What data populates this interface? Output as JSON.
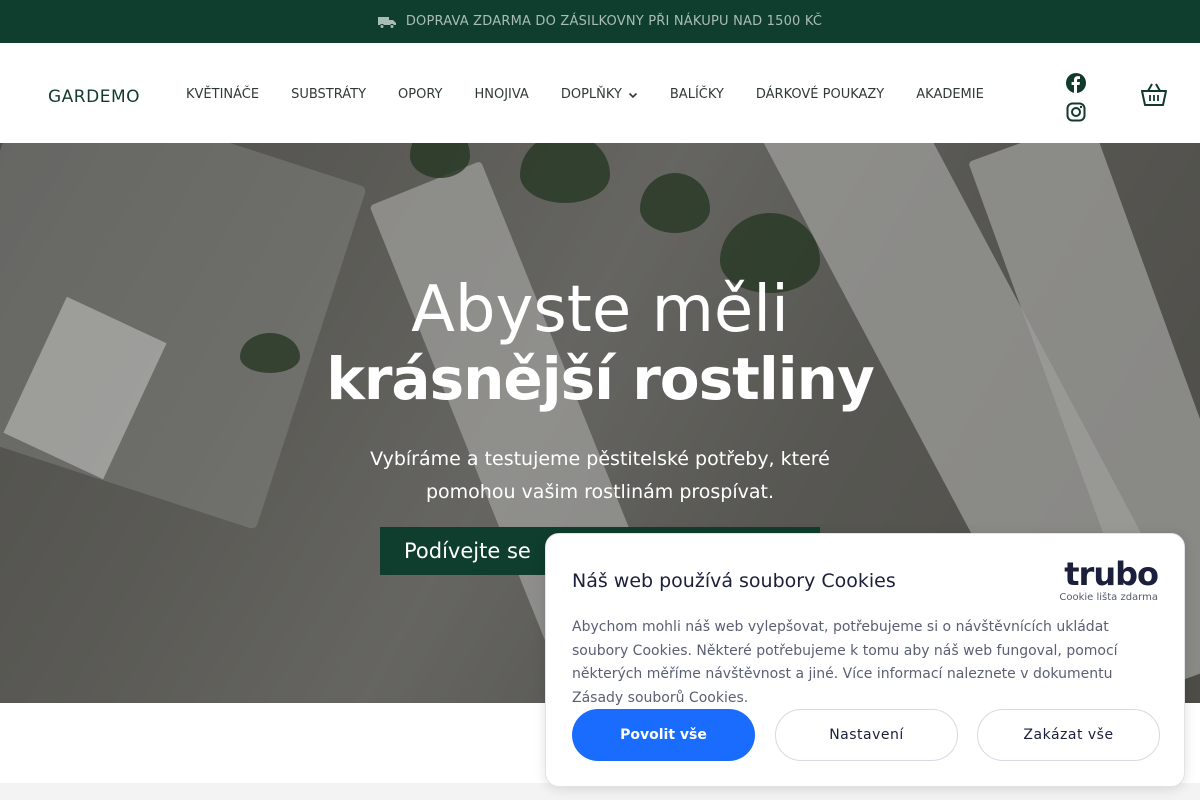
{
  "topbar": {
    "icon": "truck-icon",
    "text": "DOPRAVA ZDARMA DO ZÁSILKOVNY PŘI NÁKUPU NAD 1500 KČ"
  },
  "header": {
    "logo": "GARDEMO",
    "nav": [
      {
        "label": "KVĚTINÁČE"
      },
      {
        "label": "SUBSTRÁTY"
      },
      {
        "label": "OPORY"
      },
      {
        "label": "HNOJIVA"
      },
      {
        "label": "DOPLŇKY",
        "has_dropdown": true
      },
      {
        "label": "BALÍČKY"
      },
      {
        "label": "DÁRKOVÉ POUKAZY"
      },
      {
        "label": " AKADEMIE"
      }
    ],
    "social": [
      "facebook-icon",
      "instagram-icon"
    ],
    "cart_icon": "cart-icon"
  },
  "hero": {
    "title_line1": "Abyste měli",
    "title_line2": "krásnější rostliny",
    "subtitle": "Vybíráme a testujeme pěstitelské potřeby, které pomohou vašim rostlinám prospívat.",
    "cta": "Podívejte se"
  },
  "cookie_banner": {
    "title": "Náš web používá soubory Cookies",
    "brand": "trubo",
    "brand_tagline": "Cookie lišta zdarma",
    "body": "Abychom mohli náš web vylepšovat, potřebujeme si o návštěvnících ukládat soubory Cookies. Některé potřebujeme k tomu aby náš web fungoval, pomocí některých měříme návštěvnost a jiné. Více informací naleznete v dokumentu Zásady souborů Cookies.",
    "btn_allow": "Povolit vše",
    "btn_settings": "Nastavení",
    "btn_deny": "Zakázat vše"
  },
  "colors": {
    "brand_dark_green": "#0f3d2e",
    "cookie_accent": "#1a6cff"
  }
}
